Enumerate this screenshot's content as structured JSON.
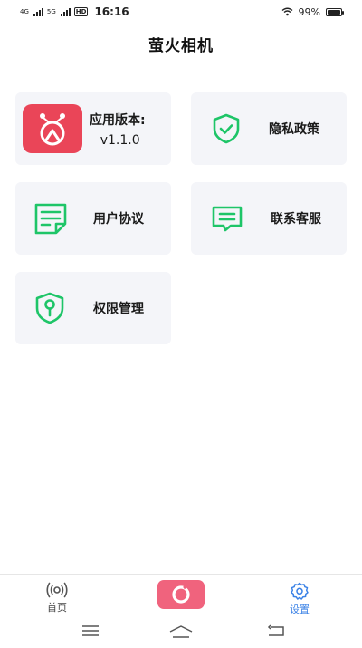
{
  "status_bar": {
    "net1": "4G",
    "net2": "5G",
    "hd": "HD",
    "time": "16:16",
    "battery": "99%",
    "battery_level": 0.99
  },
  "page": {
    "title": "萤火相机"
  },
  "cards": {
    "version": {
      "label": "应用版本:",
      "value": "v1.1.0",
      "icon": "app-logo"
    },
    "privacy": {
      "label": "隐私政策",
      "icon": "shield-check-icon"
    },
    "agreement": {
      "label": "用户协议",
      "icon": "document-icon"
    },
    "contact": {
      "label": "联系客服",
      "icon": "chat-message-icon"
    },
    "permissions": {
      "label": "权限管理",
      "icon": "shield-key-icon"
    }
  },
  "bottom_nav": {
    "home": {
      "label": "首页",
      "icon": "radio-waves-icon"
    },
    "camera": {
      "icon": "camera-ring-icon"
    },
    "settings": {
      "label": "设置",
      "icon": "gear-icon",
      "active": true
    }
  },
  "colors": {
    "accent_green": "#1ec568",
    "active_blue": "#3b82e6",
    "brand_red": "#ea4558",
    "camera_pink": "#f0637d",
    "card_bg": "#f4f5f9"
  }
}
